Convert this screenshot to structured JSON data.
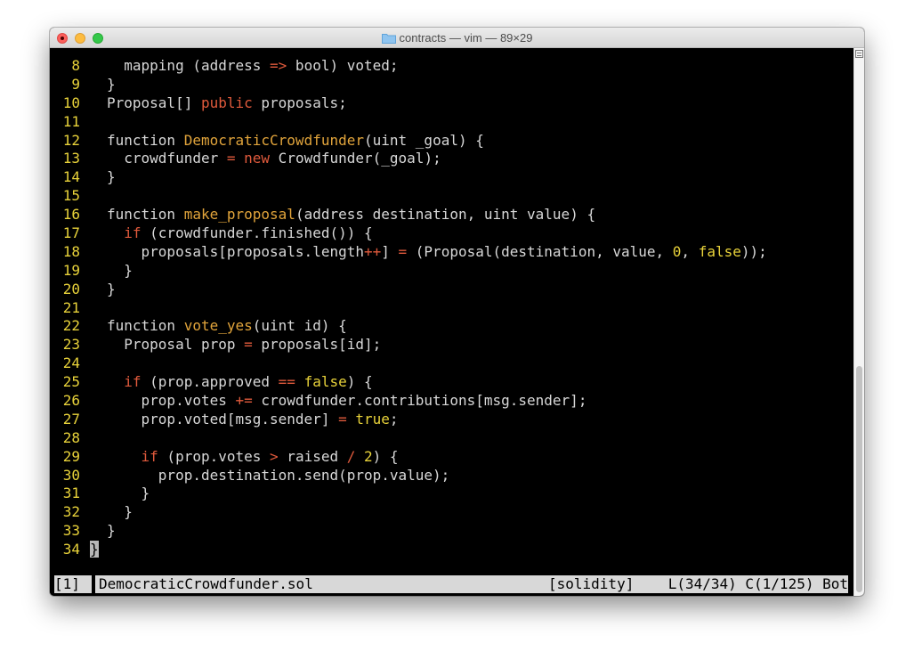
{
  "window": {
    "title": "contracts — vim — 89×29"
  },
  "editor": {
    "lines": [
      {
        "num": "8",
        "indent": "  ",
        "tokens": [
          {
            "t": "mapping (address ",
            "c": "plain"
          },
          {
            "t": "=>",
            "c": "op"
          },
          {
            "t": " bool) voted;",
            "c": "plain"
          }
        ]
      },
      {
        "num": "9",
        "indent": "",
        "tokens": [
          {
            "t": "}",
            "c": "plain"
          }
        ]
      },
      {
        "num": "10",
        "indent": "",
        "tokens": [
          {
            "t": "Proposal[] ",
            "c": "plain"
          },
          {
            "t": "public",
            "c": "kw"
          },
          {
            "t": " proposals;",
            "c": "plain"
          }
        ]
      },
      {
        "num": "11",
        "indent": "",
        "tokens": []
      },
      {
        "num": "12",
        "indent": "",
        "tokens": [
          {
            "t": "function ",
            "c": "plain"
          },
          {
            "t": "DemocraticCrowdfunder",
            "c": "fn"
          },
          {
            "t": "(uint _goal) {",
            "c": "plain"
          }
        ]
      },
      {
        "num": "13",
        "indent": "  ",
        "tokens": [
          {
            "t": "crowdfunder ",
            "c": "plain"
          },
          {
            "t": "=",
            "c": "op"
          },
          {
            "t": " ",
            "c": "plain"
          },
          {
            "t": "new",
            "c": "kw"
          },
          {
            "t": " Crowdfunder(_goal);",
            "c": "plain"
          }
        ]
      },
      {
        "num": "14",
        "indent": "",
        "tokens": [
          {
            "t": "}",
            "c": "plain"
          }
        ]
      },
      {
        "num": "15",
        "indent": "",
        "tokens": []
      },
      {
        "num": "16",
        "indent": "",
        "tokens": [
          {
            "t": "function ",
            "c": "plain"
          },
          {
            "t": "make_proposal",
            "c": "fn"
          },
          {
            "t": "(address destination, uint value) {",
            "c": "plain"
          }
        ]
      },
      {
        "num": "17",
        "indent": "  ",
        "tokens": [
          {
            "t": "if",
            "c": "kw"
          },
          {
            "t": " (crowdfunder.finished()) {",
            "c": "plain"
          }
        ]
      },
      {
        "num": "18",
        "indent": "    ",
        "tokens": [
          {
            "t": "proposals[proposals.length",
            "c": "plain"
          },
          {
            "t": "++",
            "c": "op"
          },
          {
            "t": "] ",
            "c": "plain"
          },
          {
            "t": "=",
            "c": "op"
          },
          {
            "t": " (Proposal(destination, value, ",
            "c": "plain"
          },
          {
            "t": "0",
            "c": "num"
          },
          {
            "t": ", ",
            "c": "plain"
          },
          {
            "t": "false",
            "c": "num"
          },
          {
            "t": "));",
            "c": "plain"
          }
        ]
      },
      {
        "num": "19",
        "indent": "  ",
        "tokens": [
          {
            "t": "}",
            "c": "plain"
          }
        ]
      },
      {
        "num": "20",
        "indent": "",
        "tokens": [
          {
            "t": "}",
            "c": "plain"
          }
        ]
      },
      {
        "num": "21",
        "indent": "",
        "tokens": []
      },
      {
        "num": "22",
        "indent": "",
        "tokens": [
          {
            "t": "function ",
            "c": "plain"
          },
          {
            "t": "vote_yes",
            "c": "fn"
          },
          {
            "t": "(uint id) {",
            "c": "plain"
          }
        ]
      },
      {
        "num": "23",
        "indent": "  ",
        "tokens": [
          {
            "t": "Proposal prop ",
            "c": "plain"
          },
          {
            "t": "=",
            "c": "op"
          },
          {
            "t": " proposals[id];",
            "c": "plain"
          }
        ]
      },
      {
        "num": "24",
        "indent": "",
        "tokens": []
      },
      {
        "num": "25",
        "indent": "  ",
        "tokens": [
          {
            "t": "if",
            "c": "kw"
          },
          {
            "t": " (prop.approved ",
            "c": "plain"
          },
          {
            "t": "==",
            "c": "op"
          },
          {
            "t": " ",
            "c": "plain"
          },
          {
            "t": "false",
            "c": "num"
          },
          {
            "t": ") {",
            "c": "plain"
          }
        ]
      },
      {
        "num": "26",
        "indent": "    ",
        "tokens": [
          {
            "t": "prop.votes ",
            "c": "plain"
          },
          {
            "t": "+=",
            "c": "op"
          },
          {
            "t": " crowdfunder.contributions[msg.sender];",
            "c": "plain"
          }
        ]
      },
      {
        "num": "27",
        "indent": "    ",
        "tokens": [
          {
            "t": "prop.voted[msg.sender] ",
            "c": "plain"
          },
          {
            "t": "=",
            "c": "op"
          },
          {
            "t": " ",
            "c": "plain"
          },
          {
            "t": "true",
            "c": "num"
          },
          {
            "t": ";",
            "c": "plain"
          }
        ]
      },
      {
        "num": "28",
        "indent": "",
        "tokens": []
      },
      {
        "num": "29",
        "indent": "    ",
        "tokens": [
          {
            "t": "if",
            "c": "kw"
          },
          {
            "t": " (prop.votes ",
            "c": "plain"
          },
          {
            "t": ">",
            "c": "op"
          },
          {
            "t": " raised ",
            "c": "plain"
          },
          {
            "t": "/",
            "c": "op"
          },
          {
            "t": " ",
            "c": "plain"
          },
          {
            "t": "2",
            "c": "num"
          },
          {
            "t": ") {",
            "c": "plain"
          }
        ]
      },
      {
        "num": "30",
        "indent": "      ",
        "tokens": [
          {
            "t": "prop.destination.send(prop.value);",
            "c": "plain"
          }
        ]
      },
      {
        "num": "31",
        "indent": "    ",
        "tokens": [
          {
            "t": "}",
            "c": "plain"
          }
        ]
      },
      {
        "num": "32",
        "indent": "  ",
        "tokens": [
          {
            "t": "}",
            "c": "plain"
          }
        ]
      },
      {
        "num": "33",
        "indent": "",
        "tokens": [
          {
            "t": "}",
            "c": "plain"
          }
        ]
      },
      {
        "num": "34",
        "indent": "",
        "cursor": "}",
        "tokens": []
      }
    ]
  },
  "statusline": {
    "buffer_number": "[1]",
    "filename": "DemocraticCrowdfunder.sol",
    "filetype": "[solidity]",
    "position": "L(34/34) C(1/125) Bot"
  },
  "colors": {
    "line_number": "#e8d23a",
    "keyword": "#e05a3c",
    "function_name": "#e1a43b",
    "text": "#d8d8d8",
    "background": "#000000"
  }
}
